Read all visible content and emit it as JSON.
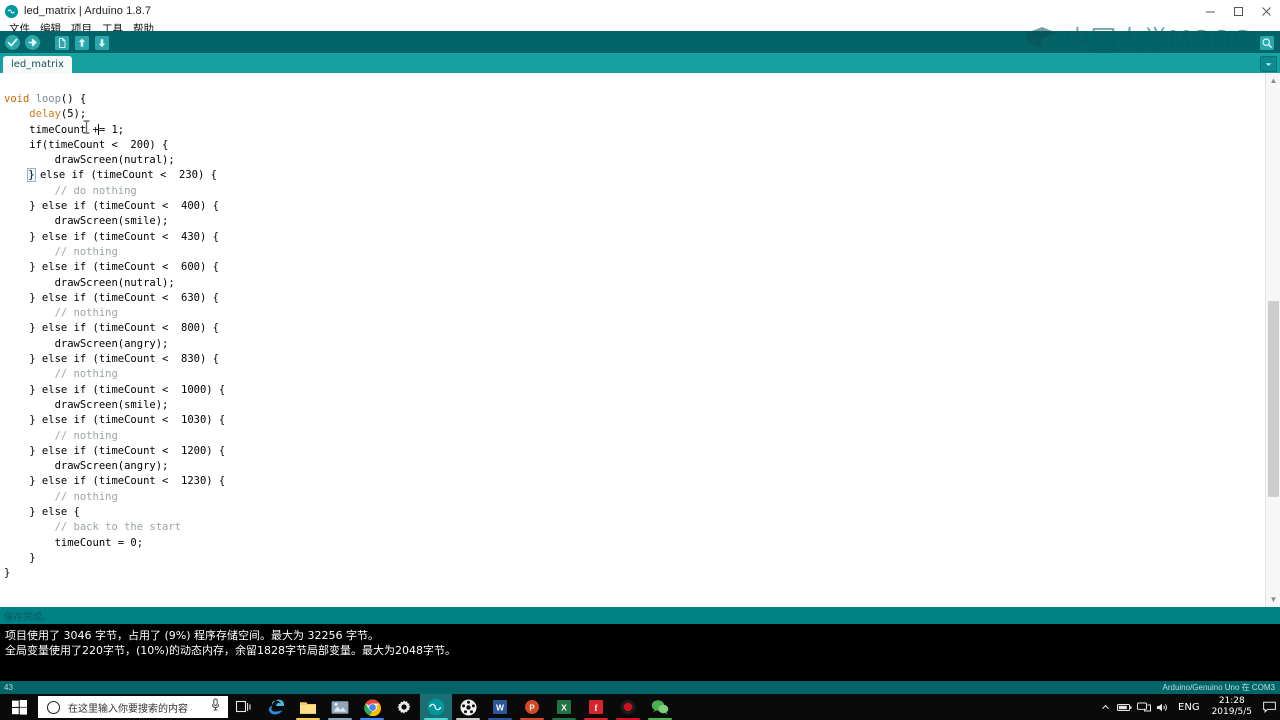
{
  "window": {
    "title": "led_matrix | Arduino 1.8.7",
    "app_icon": "arduino-infinity-icon",
    "minimize_label": "—",
    "maximize_label": "❐",
    "close_label": "✕"
  },
  "menubar": {
    "items": [
      {
        "label": "文件",
        "name": "menu-file"
      },
      {
        "label": "编辑",
        "name": "menu-edit"
      },
      {
        "label": "项目",
        "name": "menu-project"
      },
      {
        "label": "工具",
        "name": "menu-tools"
      },
      {
        "label": "帮助",
        "name": "menu-help"
      }
    ]
  },
  "toolbar": {
    "verify": "verify-icon",
    "upload": "upload-icon",
    "new": "new-sketch-icon",
    "open": "open-sketch-icon",
    "save": "save-sketch-icon",
    "serial_monitor": "serial-monitor-icon"
  },
  "watermark": {
    "text": "中国大学MOOC",
    "logo": "mooc-cap-logo"
  },
  "tabs": {
    "items": [
      {
        "label": "led_matrix",
        "active": true
      }
    ],
    "menu_icon": "chevron-down-icon"
  },
  "editor": {
    "lines": [
      [
        {
          "t": "kw",
          "s": "void"
        },
        {
          "t": "p",
          "s": " "
        },
        {
          "t": "fn",
          "s": "loop"
        },
        {
          "t": "p",
          "s": "() {"
        }
      ],
      [
        {
          "t": "p",
          "s": "    "
        },
        {
          "t": "kw2",
          "s": "delay"
        },
        {
          "t": "p",
          "s": "(5);"
        }
      ],
      [
        {
          "t": "p",
          "s": "    timeCount +"
        },
        {
          "t": "caret",
          "s": ""
        },
        {
          "t": "p",
          "s": "= 1;"
        }
      ],
      [
        {
          "t": "p",
          "s": "    if(timeCount <  200) {"
        }
      ],
      [
        {
          "t": "p",
          "s": "        drawScreen(nutral);"
        }
      ],
      [
        {
          "t": "p",
          "s": "    "
        },
        {
          "t": "brk",
          "s": "}"
        },
        {
          "t": "p",
          "s": " else if (timeCount <  230) {"
        }
      ],
      [
        {
          "t": "p",
          "s": "        "
        },
        {
          "t": "cm",
          "s": "// do nothing"
        }
      ],
      [
        {
          "t": "p",
          "s": "    } else if (timeCount <  400) {"
        }
      ],
      [
        {
          "t": "p",
          "s": "        drawScreen(smile);"
        }
      ],
      [
        {
          "t": "p",
          "s": "    } else if (timeCount <  430) {"
        }
      ],
      [
        {
          "t": "p",
          "s": "        "
        },
        {
          "t": "cm",
          "s": "// nothing"
        }
      ],
      [
        {
          "t": "p",
          "s": "    } else if (timeCount <  600) {"
        }
      ],
      [
        {
          "t": "p",
          "s": "        drawScreen(nutral);"
        }
      ],
      [
        {
          "t": "p",
          "s": "    } else if (timeCount <  630) {"
        }
      ],
      [
        {
          "t": "p",
          "s": "        "
        },
        {
          "t": "cm",
          "s": "// nothing"
        }
      ],
      [
        {
          "t": "p",
          "s": "    } else if (timeCount <  800) {"
        }
      ],
      [
        {
          "t": "p",
          "s": "        drawScreen(angry);"
        }
      ],
      [
        {
          "t": "p",
          "s": "    } else if (timeCount <  830) {"
        }
      ],
      [
        {
          "t": "p",
          "s": "        "
        },
        {
          "t": "cm",
          "s": "// nothing"
        }
      ],
      [
        {
          "t": "p",
          "s": "    } else if (timeCount <  1000) {"
        }
      ],
      [
        {
          "t": "p",
          "s": "        drawScreen(smile);"
        }
      ],
      [
        {
          "t": "p",
          "s": "    } else if (timeCount <  1030) {"
        }
      ],
      [
        {
          "t": "p",
          "s": "        "
        },
        {
          "t": "cm",
          "s": "// nothing"
        }
      ],
      [
        {
          "t": "p",
          "s": "    } else if (timeCount <  1200) {"
        }
      ],
      [
        {
          "t": "p",
          "s": "        drawScreen(angry);"
        }
      ],
      [
        {
          "t": "p",
          "s": "    } else if (timeCount <  1230) {"
        }
      ],
      [
        {
          "t": "p",
          "s": "        "
        },
        {
          "t": "cm",
          "s": "// nothing"
        }
      ],
      [
        {
          "t": "p",
          "s": "    } else {"
        }
      ],
      [
        {
          "t": "p",
          "s": "        "
        },
        {
          "t": "cm",
          "s": "// back to the start"
        }
      ],
      [
        {
          "t": "p",
          "s": "        timeCount = 0;"
        }
      ],
      [
        {
          "t": "p",
          "s": "    }"
        }
      ],
      [
        {
          "t": "p",
          "s": "}"
        }
      ]
    ],
    "scrollbar": {
      "up": "▲",
      "down": "▼"
    }
  },
  "status_strip": {
    "message": "保存完成。"
  },
  "console": {
    "lines": [
      "项目使用了 3046 字节，占用了 (9%) 程序存储空间。最大为 32256 字节。",
      "全局变量使用了220字节，(10%)的动态内存，余留1828字节局部变量。最大为2048字节。"
    ]
  },
  "bottom_bar": {
    "line_number": "43",
    "board_info": "Arduino/Genuino Uno 在 COM3"
  },
  "taskbar": {
    "start": "windows-start-icon",
    "search_placeholder": "在这里输入你要搜索的内容",
    "search_value": "",
    "mic": "microphone-icon",
    "apps": [
      {
        "name": "task-view-icon",
        "label": "任务视图"
      },
      {
        "name": "edge-icon",
        "label": "Microsoft Edge"
      },
      {
        "name": "file-explorer-icon",
        "label": "文件资源管理器"
      },
      {
        "name": "photos-icon",
        "label": "照片"
      },
      {
        "name": "chrome-icon",
        "label": "Google Chrome"
      },
      {
        "name": "settings-icon",
        "label": "设置"
      },
      {
        "name": "arduino-icon",
        "label": "Arduino"
      },
      {
        "name": "media-player-icon",
        "label": "播放器"
      },
      {
        "name": "word-icon",
        "label": "Word"
      },
      {
        "name": "powerpoint-icon",
        "label": "PowerPoint"
      },
      {
        "name": "excel-icon",
        "label": "Excel"
      },
      {
        "name": "foxit-icon",
        "label": "Foxit"
      },
      {
        "name": "recorder-icon",
        "label": "录制"
      },
      {
        "name": "wechat-icon",
        "label": "微信"
      }
    ],
    "tray": {
      "language": "ENG",
      "time": "21:28",
      "date": "2019/5/5",
      "notification": "notification-icon"
    }
  },
  "colors": {
    "toolbar_teal": "#006468",
    "tabbar_teal": "#16a0a0",
    "status_teal": "#008184",
    "console_bg": "#000000",
    "keyword_orange": "#cc6600",
    "comment_grey": "#9aa5a8"
  }
}
